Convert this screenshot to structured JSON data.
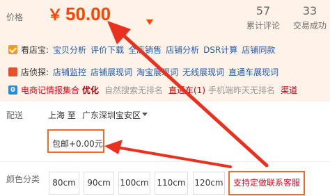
{
  "price": {
    "label": "价格",
    "currency": "￥",
    "value": "50.00"
  },
  "stats": [
    {
      "number": "57",
      "label": "累计评论"
    },
    {
      "number": "33",
      "label": "交易成功"
    }
  ],
  "plugins": {
    "kandianbao": {
      "name": "看店宝:",
      "links": [
        "宝贝分析",
        "评价下载",
        "全店销售",
        "店铺分析",
        "DSR计算",
        "店铺同款"
      ]
    },
    "dianzhentan": {
      "name": "店侦探:",
      "links": [
        "店铺监控",
        "店铺展现词",
        "淘宝展现词",
        "无线展现词",
        "直通车展现词"
      ]
    },
    "dianshangji": {
      "icon_text": "0",
      "title": "电商记情报集合",
      "highlight": "优化",
      "grey1": "自然搜索无排名",
      "ztc": "直通车(1)",
      "grey2": "手机端昨天无排名",
      "channel": "渠道"
    }
  },
  "shipping": {
    "label": "配送",
    "from": "上海 至",
    "to": "广东深圳宝安区",
    "postage": "包邮+0.00元"
  },
  "color_options": {
    "label": "颜色分类",
    "options": [
      "80cm",
      "90cm",
      "100cm",
      "110cm",
      "120cm"
    ],
    "custom": "支持定做联系客服"
  },
  "colors": {
    "accent": "#ff4400",
    "highlight_box": "#f06a23",
    "link": "#1f5ba8",
    "arrow": "#e8311f"
  }
}
